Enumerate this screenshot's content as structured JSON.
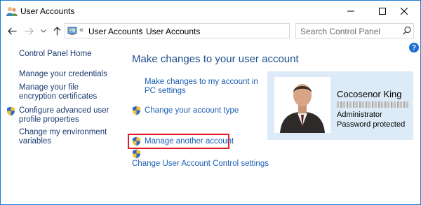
{
  "window": {
    "title": "User Accounts"
  },
  "address": {
    "overflow": "«",
    "segments": [
      "User Accounts",
      "User Accounts"
    ],
    "search_placeholder": "Search Control Panel"
  },
  "left_pane": {
    "home": "Control Panel Home",
    "items": [
      {
        "label": "Manage your credentials",
        "shield": false
      },
      {
        "label": "Manage your file encryption certificates",
        "shield": false
      },
      {
        "label": "Configure advanced user profile properties",
        "shield": true
      },
      {
        "label": "Change my environment variables",
        "shield": false
      }
    ]
  },
  "main": {
    "title": "Make changes to your user account",
    "tasks": [
      {
        "label": "Make changes to my account in PC settings",
        "shield": false
      },
      {
        "label": "Change your account type",
        "shield": true
      },
      {
        "label": "Manage another account",
        "shield": true,
        "highlighted": true
      },
      {
        "label": "Change User Account Control settings",
        "shield": true
      }
    ]
  },
  "account": {
    "name": "Cocosenor King",
    "role": "Administrator",
    "password_status": "Password protected"
  },
  "colors": {
    "link": "#1a5fb4",
    "title": "#1e4e8c",
    "highlight_border": "#e01e24",
    "tile_bg": "#dcebf7",
    "window_border": "#1a7fd1"
  },
  "icons": {
    "app": "user-accounts-icon",
    "help": "help-icon",
    "search": "search-icon",
    "uac": "uac-shield-icon"
  }
}
